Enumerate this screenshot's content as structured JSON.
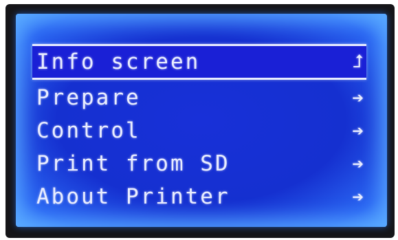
{
  "menu": {
    "items": [
      {
        "label": "Info screen",
        "arrow": "⮥",
        "selected": true
      },
      {
        "label": "Prepare",
        "arrow": "➔",
        "selected": false
      },
      {
        "label": "Control",
        "arrow": "➔",
        "selected": false
      },
      {
        "label": "Print from SD",
        "arrow": "➔",
        "selected": false
      },
      {
        "label": "About Printer",
        "arrow": "➔",
        "selected": false
      }
    ]
  },
  "colors": {
    "lcd_background": "#1530d0",
    "text": "#e8ecff",
    "bezel": "#151518"
  }
}
